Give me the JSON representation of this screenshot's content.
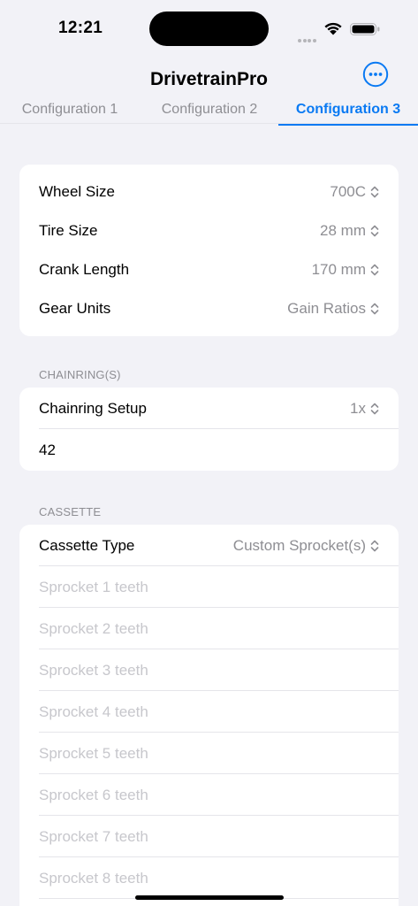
{
  "status": {
    "time": "12:21"
  },
  "header": {
    "title": "DrivetrainPro"
  },
  "tabs": [
    {
      "label": "Configuration 1",
      "active": false
    },
    {
      "label": "Configuration 2",
      "active": false
    },
    {
      "label": "Configuration 3",
      "active": true
    }
  ],
  "settings": [
    {
      "label": "Wheel Size",
      "value": "700C"
    },
    {
      "label": "Tire Size",
      "value": "28 mm"
    },
    {
      "label": "Crank Length",
      "value": "170 mm"
    },
    {
      "label": "Gear Units",
      "value": "Gain Ratios"
    }
  ],
  "chainring": {
    "header": "CHAINRING(S)",
    "setup_label": "Chainring Setup",
    "setup_value": "1x",
    "teeth_value": "42"
  },
  "cassette": {
    "header": "CASSETTE",
    "type_label": "Cassette Type",
    "type_value": "Custom Sprocket(s)",
    "sprockets": [
      "Sprocket 1 teeth",
      "Sprocket 2 teeth",
      "Sprocket 3 teeth",
      "Sprocket 4 teeth",
      "Sprocket 5 teeth",
      "Sprocket 6 teeth",
      "Sprocket 7 teeth",
      "Sprocket 8 teeth"
    ]
  },
  "colors": {
    "accent": "#0a7af3",
    "background": "#f2f2f7",
    "secondary_text": "#8e8e93",
    "placeholder": "#c7c7cc"
  }
}
